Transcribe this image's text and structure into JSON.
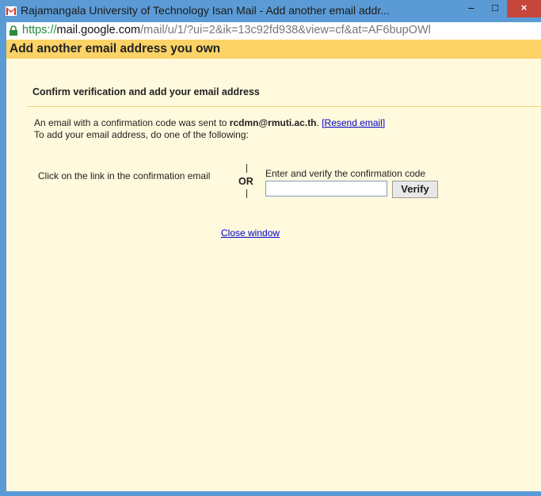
{
  "window": {
    "title": "Rajamangala University of Technology Isan Mail - Add another email addr...",
    "minimize_glyph": "‒",
    "maximize_glyph": "□",
    "close_glyph": "×"
  },
  "addressbar": {
    "scheme": "https://",
    "host": "mail.google.com",
    "path": "/mail/u/1/?ui=2&ik=13c92fd938&view=cf&at=AF6bupOWl"
  },
  "page": {
    "title": "Add another email address you own",
    "section_title": "Confirm verification and add your email address",
    "sent_prefix": "An email with a confirmation code was sent to ",
    "email": "rcdmn@rmuti.ac.th",
    "sent_suffix": ". ",
    "resend_link": "[Resend email]",
    "instruction": "To add your email address, do one of the following:",
    "option1": "Click on the link in the confirmation email",
    "or_label": "OR",
    "option2": "Enter and verify the confirmation code",
    "code_value": "",
    "verify_button": "Verify",
    "close_link": "Close window"
  },
  "colors": {
    "titlebar": "#5b9bd5",
    "header": "#fbd366",
    "content_bg": "#fff9dd",
    "link": "#0000cc",
    "close_button": "#c7463c"
  },
  "icons": {
    "app": "gmail-icon",
    "lock": "lock-icon"
  }
}
